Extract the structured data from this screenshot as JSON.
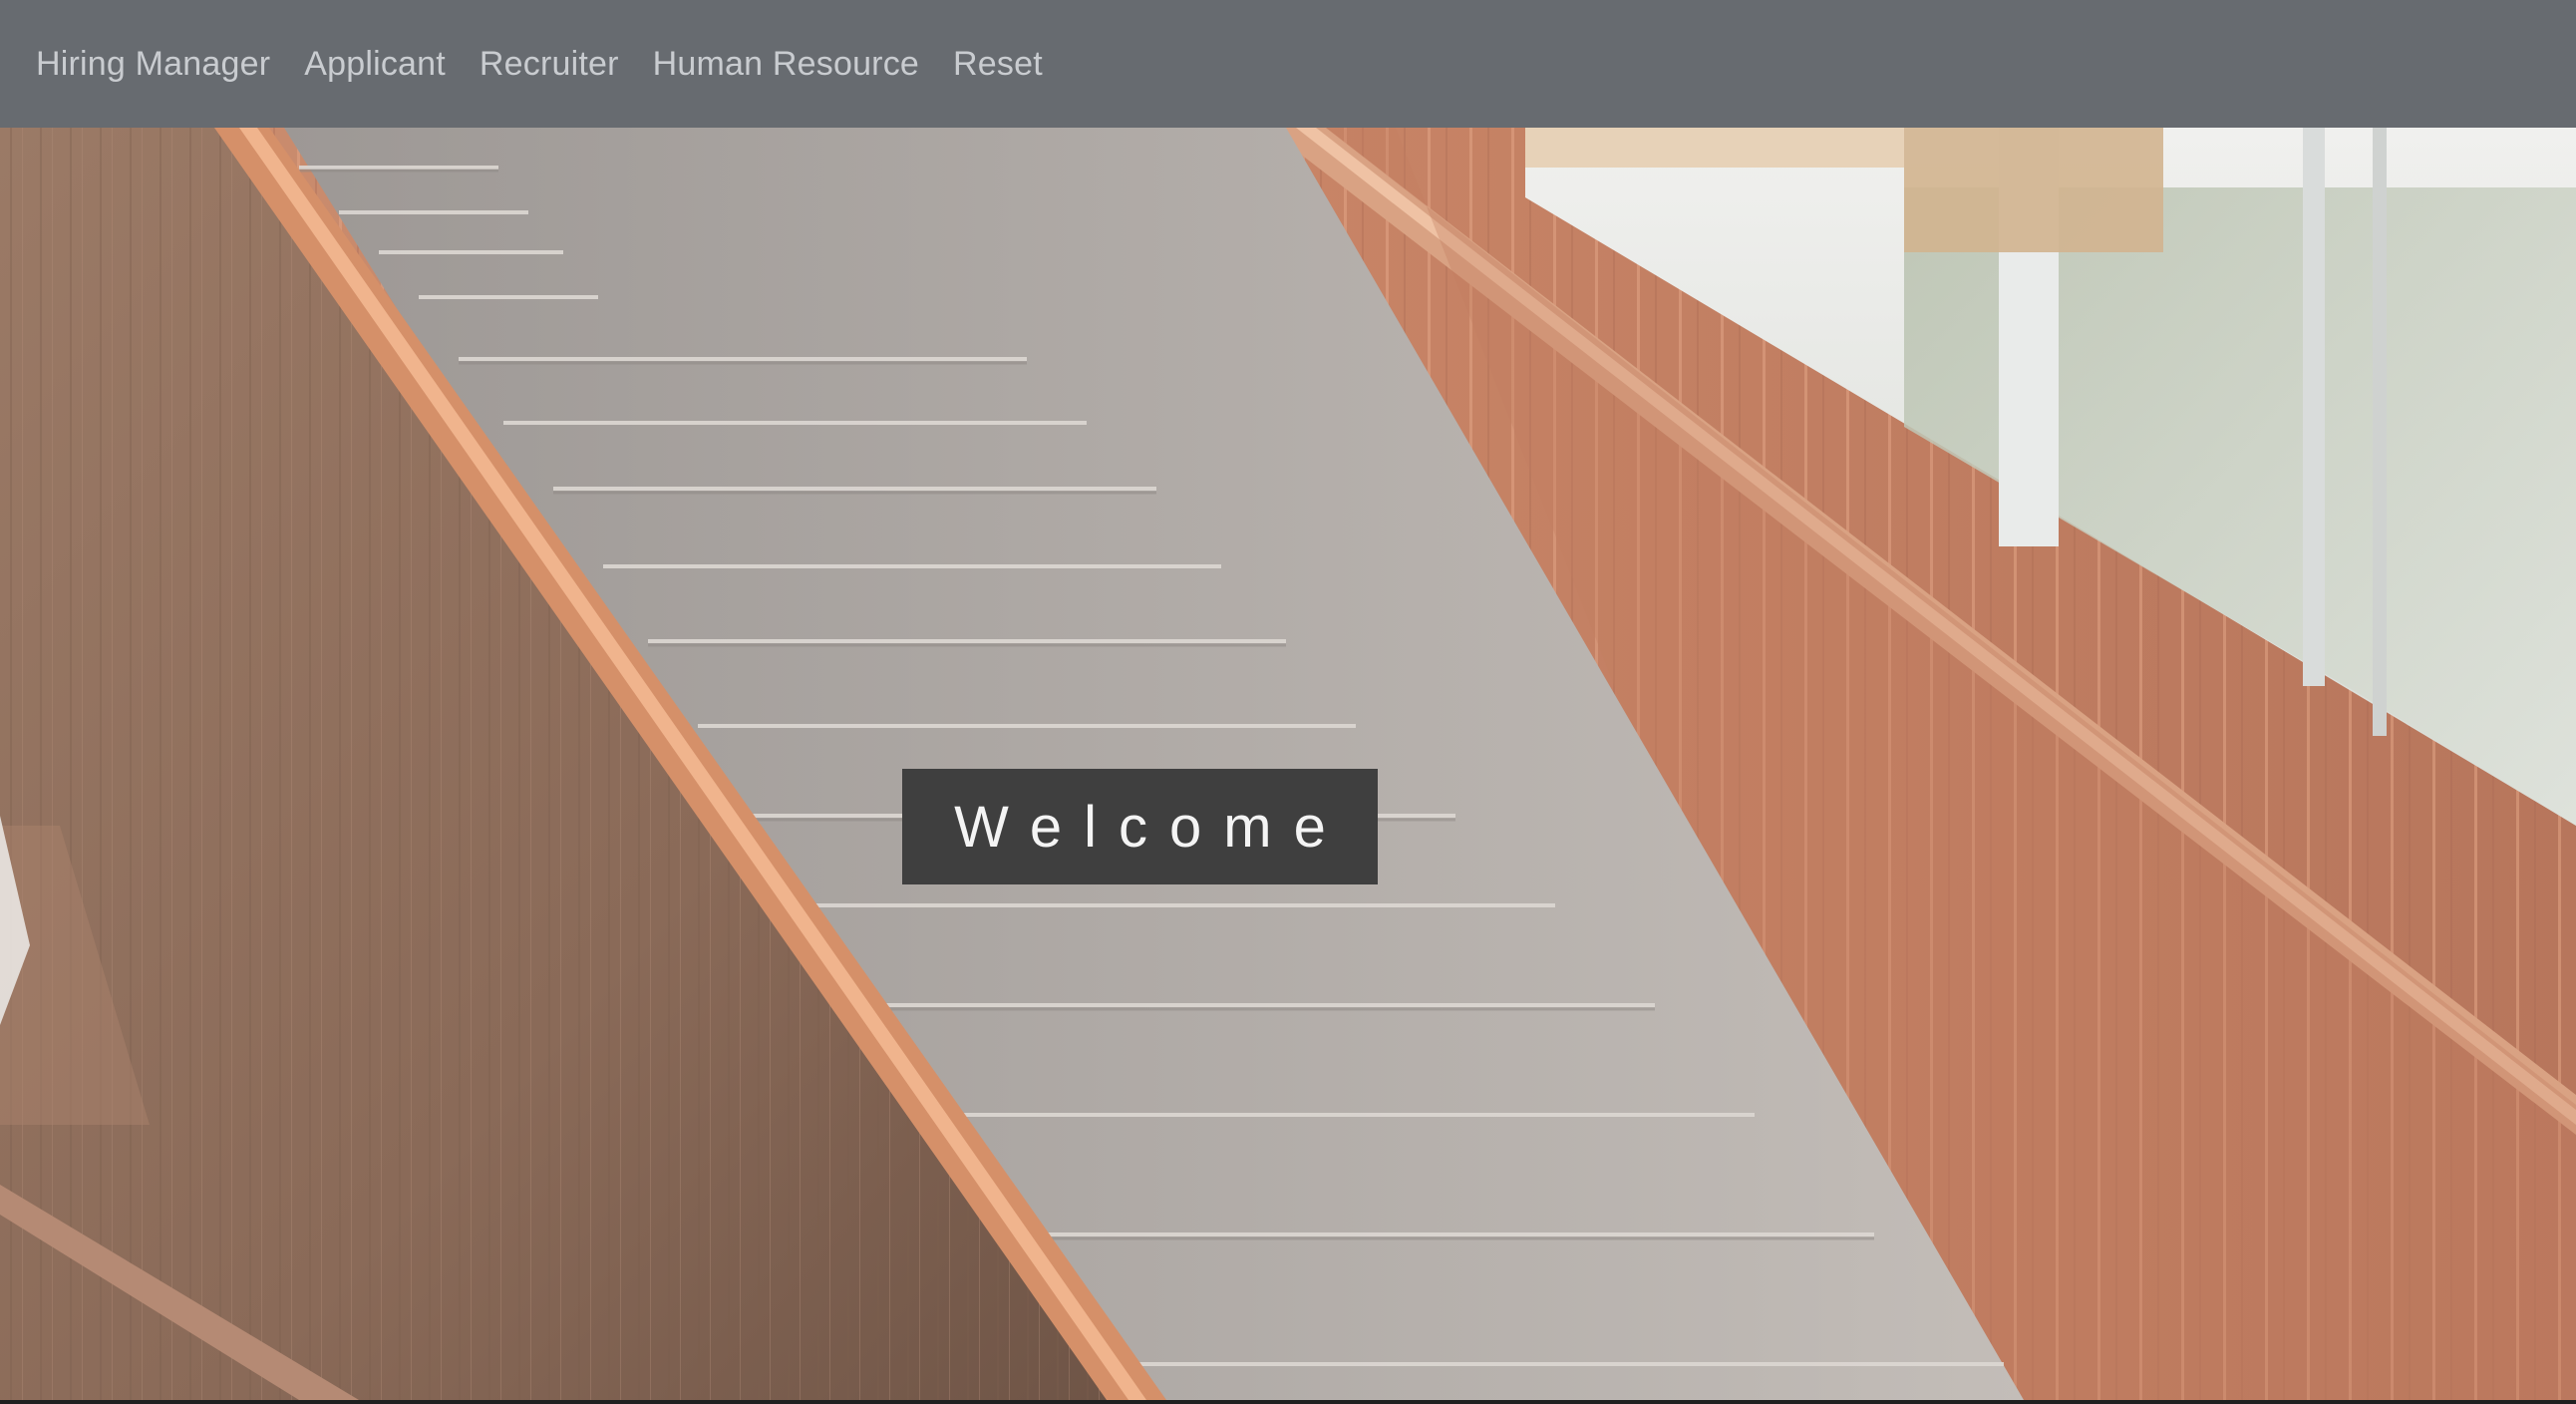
{
  "nav": {
    "items": [
      {
        "label": "Hiring Manager"
      },
      {
        "label": "Applicant"
      },
      {
        "label": "Recruiter"
      },
      {
        "label": "Human Resource"
      },
      {
        "label": "Reset"
      }
    ]
  },
  "hero": {
    "welcome_label": "Welcome",
    "image_icon": "staircase-photo"
  },
  "colors": {
    "navbar_bg": "#676b70",
    "nav_text": "#c9ccd0",
    "welcome_bg": "#3f3f3f",
    "welcome_text": "#f4f4f4",
    "wood": "#c48566"
  }
}
